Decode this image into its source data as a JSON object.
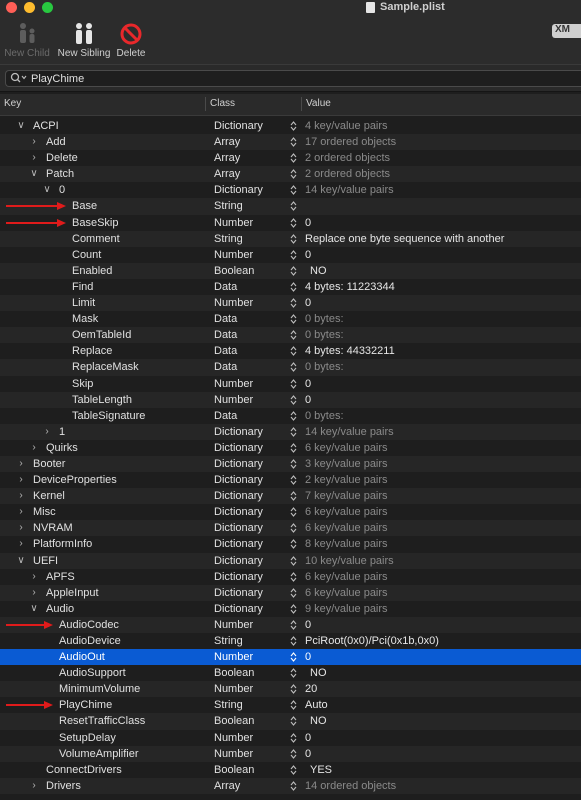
{
  "window": {
    "title": "Sample.plist"
  },
  "toolbar": {
    "new_child_label": "New Child",
    "new_sibling_label": "New Sibling",
    "delete_label": "Delete",
    "format_label": "XM"
  },
  "search": {
    "value": "PlayChime"
  },
  "header": {
    "key": "Key",
    "class": "Class",
    "value": "Value"
  },
  "colors": {
    "selection": "#0a5bd3",
    "annotation_arrow": "#e01b1b"
  },
  "rows": [
    {
      "key": "ACPI",
      "depth": 0,
      "tri": "open",
      "class": "Dictionary",
      "value": "4 key/value pairs",
      "dim": true
    },
    {
      "key": "Add",
      "depth": 1,
      "tri": "closed",
      "class": "Array",
      "value": "17 ordered objects",
      "dim": true
    },
    {
      "key": "Delete",
      "depth": 1,
      "tri": "closed",
      "class": "Array",
      "value": "2 ordered objects",
      "dim": true
    },
    {
      "key": "Patch",
      "depth": 1,
      "tri": "open",
      "class": "Array",
      "value": "2 ordered objects",
      "dim": true
    },
    {
      "key": "0",
      "depth": 2,
      "tri": "open",
      "class": "Dictionary",
      "value": "14 key/value pairs",
      "dim": true
    },
    {
      "key": "Base",
      "depth": 3,
      "class": "String",
      "value": "",
      "arrow": true
    },
    {
      "key": "BaseSkip",
      "depth": 3,
      "class": "Number",
      "value": "0",
      "arrow": true
    },
    {
      "key": "Comment",
      "depth": 3,
      "class": "String",
      "value": "Replace one byte sequence with another"
    },
    {
      "key": "Count",
      "depth": 3,
      "class": "Number",
      "value": "0"
    },
    {
      "key": "Enabled",
      "depth": 3,
      "class": "Boolean",
      "value": "NO"
    },
    {
      "key": "Find",
      "depth": 3,
      "class": "Data",
      "value": "4 bytes: 11223344"
    },
    {
      "key": "Limit",
      "depth": 3,
      "class": "Number",
      "value": "0"
    },
    {
      "key": "Mask",
      "depth": 3,
      "class": "Data",
      "value": "0 bytes:",
      "dim": true
    },
    {
      "key": "OemTableId",
      "depth": 3,
      "class": "Data",
      "value": "0 bytes:",
      "dim": true
    },
    {
      "key": "Replace",
      "depth": 3,
      "class": "Data",
      "value": "4 bytes: 44332211"
    },
    {
      "key": "ReplaceMask",
      "depth": 3,
      "class": "Data",
      "value": "0 bytes:",
      "dim": true
    },
    {
      "key": "Skip",
      "depth": 3,
      "class": "Number",
      "value": "0"
    },
    {
      "key": "TableLength",
      "depth": 3,
      "class": "Number",
      "value": "0"
    },
    {
      "key": "TableSignature",
      "depth": 3,
      "class": "Data",
      "value": "0 bytes:",
      "dim": true
    },
    {
      "key": "1",
      "depth": 2,
      "tri": "closed",
      "class": "Dictionary",
      "value": "14 key/value pairs",
      "dim": true
    },
    {
      "key": "Quirks",
      "depth": 1,
      "tri": "closed",
      "class": "Dictionary",
      "value": "6 key/value pairs",
      "dim": true
    },
    {
      "key": "Booter",
      "depth": 0,
      "tri": "closed",
      "class": "Dictionary",
      "value": "3 key/value pairs",
      "dim": true
    },
    {
      "key": "DeviceProperties",
      "depth": 0,
      "tri": "closed",
      "class": "Dictionary",
      "value": "2 key/value pairs",
      "dim": true
    },
    {
      "key": "Kernel",
      "depth": 0,
      "tri": "closed",
      "class": "Dictionary",
      "value": "7 key/value pairs",
      "dim": true
    },
    {
      "key": "Misc",
      "depth": 0,
      "tri": "closed",
      "class": "Dictionary",
      "value": "6 key/value pairs",
      "dim": true
    },
    {
      "key": "NVRAM",
      "depth": 0,
      "tri": "closed",
      "class": "Dictionary",
      "value": "6 key/value pairs",
      "dim": true
    },
    {
      "key": "PlatformInfo",
      "depth": 0,
      "tri": "closed",
      "class": "Dictionary",
      "value": "8 key/value pairs",
      "dim": true
    },
    {
      "key": "UEFI",
      "depth": 0,
      "tri": "open",
      "class": "Dictionary",
      "value": "10 key/value pairs",
      "dim": true
    },
    {
      "key": "APFS",
      "depth": 1,
      "tri": "closed",
      "class": "Dictionary",
      "value": "6 key/value pairs",
      "dim": true
    },
    {
      "key": "AppleInput",
      "depth": 1,
      "tri": "closed",
      "class": "Dictionary",
      "value": "6 key/value pairs",
      "dim": true
    },
    {
      "key": "Audio",
      "depth": 1,
      "tri": "open",
      "class": "Dictionary",
      "value": "9 key/value pairs",
      "dim": true
    },
    {
      "key": "AudioCodec",
      "depth": 2,
      "class": "Number",
      "value": "0",
      "arrow": true
    },
    {
      "key": "AudioDevice",
      "depth": 2,
      "class": "String",
      "value": "PciRoot(0x0)/Pci(0x1b,0x0)"
    },
    {
      "key": "AudioOut",
      "depth": 2,
      "class": "Number",
      "value": "0",
      "selected": true
    },
    {
      "key": "AudioSupport",
      "depth": 2,
      "class": "Boolean",
      "value": "NO"
    },
    {
      "key": "MinimumVolume",
      "depth": 2,
      "class": "Number",
      "value": "20"
    },
    {
      "key": "PlayChime",
      "depth": 2,
      "class": "String",
      "value": "Auto",
      "arrow": true
    },
    {
      "key": "ResetTrafficClass",
      "depth": 2,
      "class": "Boolean",
      "value": "NO"
    },
    {
      "key": "SetupDelay",
      "depth": 2,
      "class": "Number",
      "value": "0"
    },
    {
      "key": "VolumeAmplifier",
      "depth": 2,
      "class": "Number",
      "value": "0"
    },
    {
      "key": "ConnectDrivers",
      "depth": 1,
      "class": "Boolean",
      "value": "YES"
    },
    {
      "key": "Drivers",
      "depth": 1,
      "tri": "closed",
      "class": "Array",
      "value": "14 ordered objects",
      "dim": true
    }
  ]
}
